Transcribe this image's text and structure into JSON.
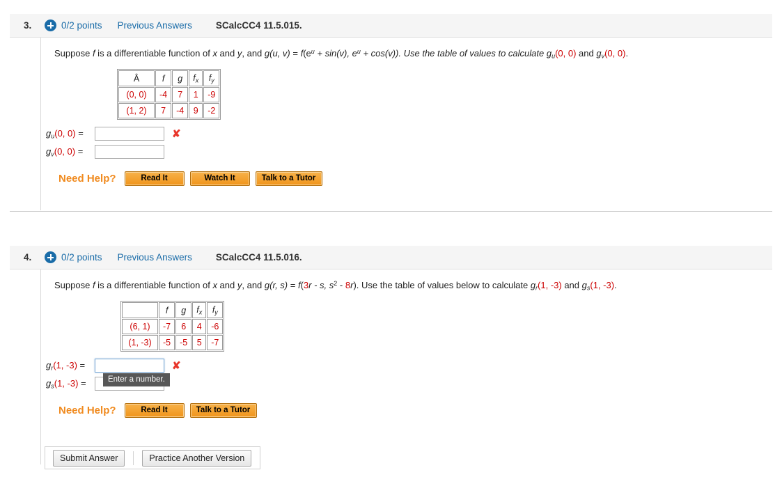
{
  "questions": [
    {
      "number": "3.",
      "points": "0/2 points",
      "previous_answers": "Previous Answers",
      "code": "SCalcCC4 11.5.015.",
      "plus_icon": "plus-circle-icon",
      "statement": {
        "p1": "Suppose ",
        "f1": "f",
        "p2": " is a differentiable function of ",
        "x": "x",
        "p3": " and ",
        "y": "y",
        "p4": ", and ",
        "g": "g",
        "args": "(u, v)",
        "eq": " = ",
        "f2": "f",
        "body_open": "(e",
        "sup1": "u",
        "body_mid": " + sin(v), e",
        "sup2": "u",
        "body_end": " + cos(v)). Use the table of values to calculate ",
        "gu": "g",
        "gu_sub": "u",
        "gu_pt": "(0, 0)",
        "and": " and ",
        "gv": "g",
        "gv_sub": "v",
        "gv_pt": "(0, 0)",
        "period": "."
      },
      "table": {
        "headers": [
          "Â",
          "f",
          "g",
          "fx",
          "fy"
        ],
        "headers_display": [
          "Â",
          "f",
          "g",
          "f",
          "f"
        ],
        "header_subs": [
          "",
          "",
          "",
          "x",
          "y"
        ],
        "rows": [
          {
            "point": "(0, 0)",
            "values": [
              "-4",
              "7",
              "1",
              "-9"
            ]
          },
          {
            "point": "(1, 2)",
            "values": [
              "7",
              "-4",
              "9",
              "-2"
            ]
          }
        ]
      },
      "answers": [
        {
          "label_fn": "g",
          "label_sub": "u",
          "label_pt": "(0, 0)",
          "label_eq": " = ",
          "value": "",
          "focused": false,
          "mark": "✘",
          "tooltip": ""
        },
        {
          "label_fn": "g",
          "label_sub": "v",
          "label_pt": "(0, 0)",
          "label_eq": " = ",
          "value": "",
          "focused": false,
          "mark": "",
          "tooltip": ""
        }
      ],
      "need_help": {
        "label": "Need Help?",
        "buttons": [
          "Read It",
          "Watch It",
          "Talk to a Tutor"
        ]
      }
    },
    {
      "number": "4.",
      "points": "0/2 points",
      "previous_answers": "Previous Answers",
      "code": "SCalcCC4 11.5.016.",
      "plus_icon": "plus-circle-icon",
      "statement": {
        "p1": "Suppose ",
        "f1": "f",
        "p2": " is a differentiable function of ",
        "x": "x",
        "p3": " and ",
        "y": "y",
        "p4": ", and ",
        "g": "g",
        "args": "(r, s)",
        "eq": " = ",
        "f2": "f",
        "body_open": "(",
        "num3": "3",
        "r1": "r",
        "minus_s": " - s, s",
        "sup_two": "2",
        "minus": " - ",
        "num8": "8",
        "r2": "r",
        "body_end": "). Use the table of values below to calculate ",
        "gr": "g",
        "gr_sub": "r",
        "gr_pt": "(1, -3)",
        "and": " and ",
        "gs": "g",
        "gs_sub": "s",
        "gs_pt": "(1, -3)",
        "period": "."
      },
      "table": {
        "headers": [
          "",
          "f",
          "g",
          "fx",
          "fy"
        ],
        "headers_display": [
          "",
          "f",
          "g",
          "f",
          "f"
        ],
        "header_subs": [
          "",
          "",
          "",
          "x",
          "y"
        ],
        "rows": [
          {
            "point": "(6, 1)",
            "values": [
              "-7",
              "6",
              "4",
              "-6"
            ]
          },
          {
            "point": "(1, -3)",
            "values": [
              "-5",
              "-5",
              "5",
              "-7"
            ]
          }
        ]
      },
      "answers": [
        {
          "label_fn": "g",
          "label_sub": "r",
          "label_pt": "(1, -3)",
          "label_eq": " = ",
          "value": "",
          "focused": true,
          "mark": "✘",
          "tooltip": "Enter a number."
        },
        {
          "label_fn": "g",
          "label_sub": "s",
          "label_pt": "(1, -3)",
          "label_eq": " = ",
          "value": "",
          "focused": false,
          "mark": "",
          "tooltip": ""
        }
      ],
      "need_help": {
        "label": "Need Help?",
        "buttons": [
          "Read It",
          "Talk to a Tutor"
        ]
      }
    }
  ],
  "footer": {
    "submit_label": "Submit Answer",
    "practice_label": "Practice Another Version"
  },
  "colors": {
    "link": "#1a6ca8",
    "value_red": "#cc0000",
    "error_red": "#e8352a",
    "help_orange": "#f08a1e",
    "header_bg": "#f5f5f5"
  }
}
